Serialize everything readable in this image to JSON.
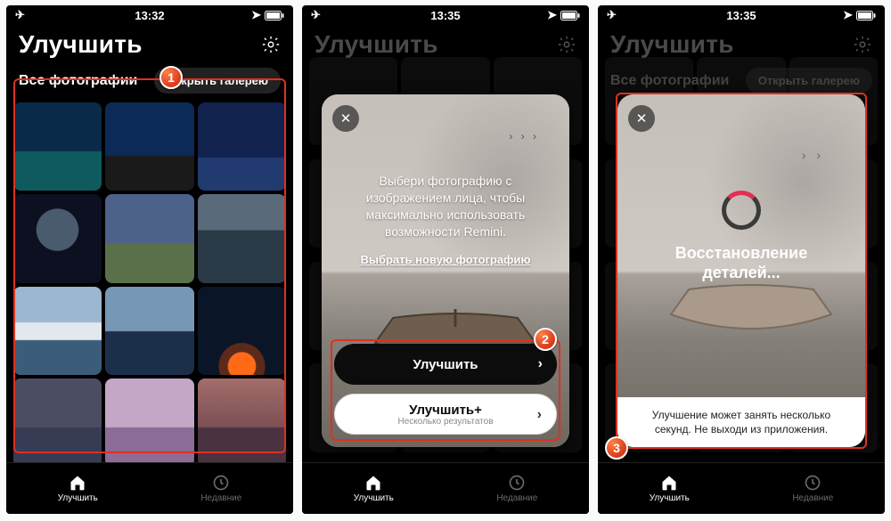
{
  "status_times": [
    "13:32",
    "13:35",
    "13:35"
  ],
  "header_title": "Улучшить",
  "gallery": {
    "subtitle": "Все фотографии",
    "open_gallery": "Открыть галерею"
  },
  "nav": {
    "enhance": "Улучшить",
    "recent": "Недавние"
  },
  "steps": {
    "1": "1",
    "2": "2",
    "3": "3"
  },
  "card2": {
    "prompt_l1": "Выбери фотографию с",
    "prompt_l2": "изображением лица, чтобы",
    "prompt_l3": "максимально использовать",
    "prompt_l4": "возможности Remini.",
    "link": "Выбрать новую фотографию",
    "btn_enhance": "Улучшить",
    "btn_enhance_plus": "Улучшить+",
    "btn_enhance_plus_sub": "Несколько результатов"
  },
  "card3": {
    "spin_l1": "Восстановление",
    "spin_l2": "деталей...",
    "note": "Улучшение может занять несколько секунд. Не выходи из приложения."
  },
  "icons": {
    "airplane": "✈",
    "location": "➤",
    "battery_box": "▢",
    "chevron": "›",
    "close": "✕"
  }
}
